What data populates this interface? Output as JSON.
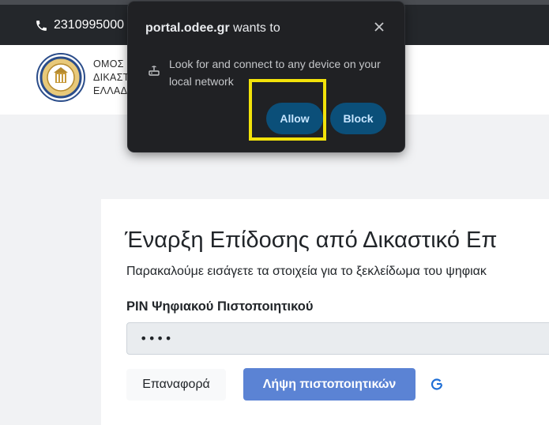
{
  "topbar": {
    "phone_number": "2310995000",
    "phone_icon": "phone-icon"
  },
  "header": {
    "org_lines": [
      "ΟΜΟΣ",
      "ΔΙΚΑΣΤ",
      "ΕΛΛΑΔ"
    ],
    "logo": "association-seal-logo"
  },
  "permission_popup": {
    "site": "portal.odee.gr",
    "wants_to": " wants to",
    "request_text": "Look for and connect to any device on your local network",
    "request_icon": "local-network-icon",
    "allow_label": "Allow",
    "block_label": "Block",
    "close_icon": "close-icon"
  },
  "form": {
    "title": "Έναρξη Επίδοσης από Δικαστικό Επ",
    "subtitle": "Παρακαλούμε εισάγετε τα στοιχεία για το ξεκλείδωμα του ψηφιακ",
    "pin_label": "PIN Ψηφιακού Πιστοποιητικού",
    "pin_value": "••••",
    "reset_label": "Επαναφορά",
    "get_certs_label": "Λήψη πιστοποιητικών",
    "refresh_icon": "refresh-icon"
  },
  "colors": {
    "topbar_bg": "#24272b",
    "popup_bg": "#202124",
    "popup_button_bg": "#0b4f79",
    "primary_button": "#5b83d4",
    "highlight": "#f2e20a"
  }
}
